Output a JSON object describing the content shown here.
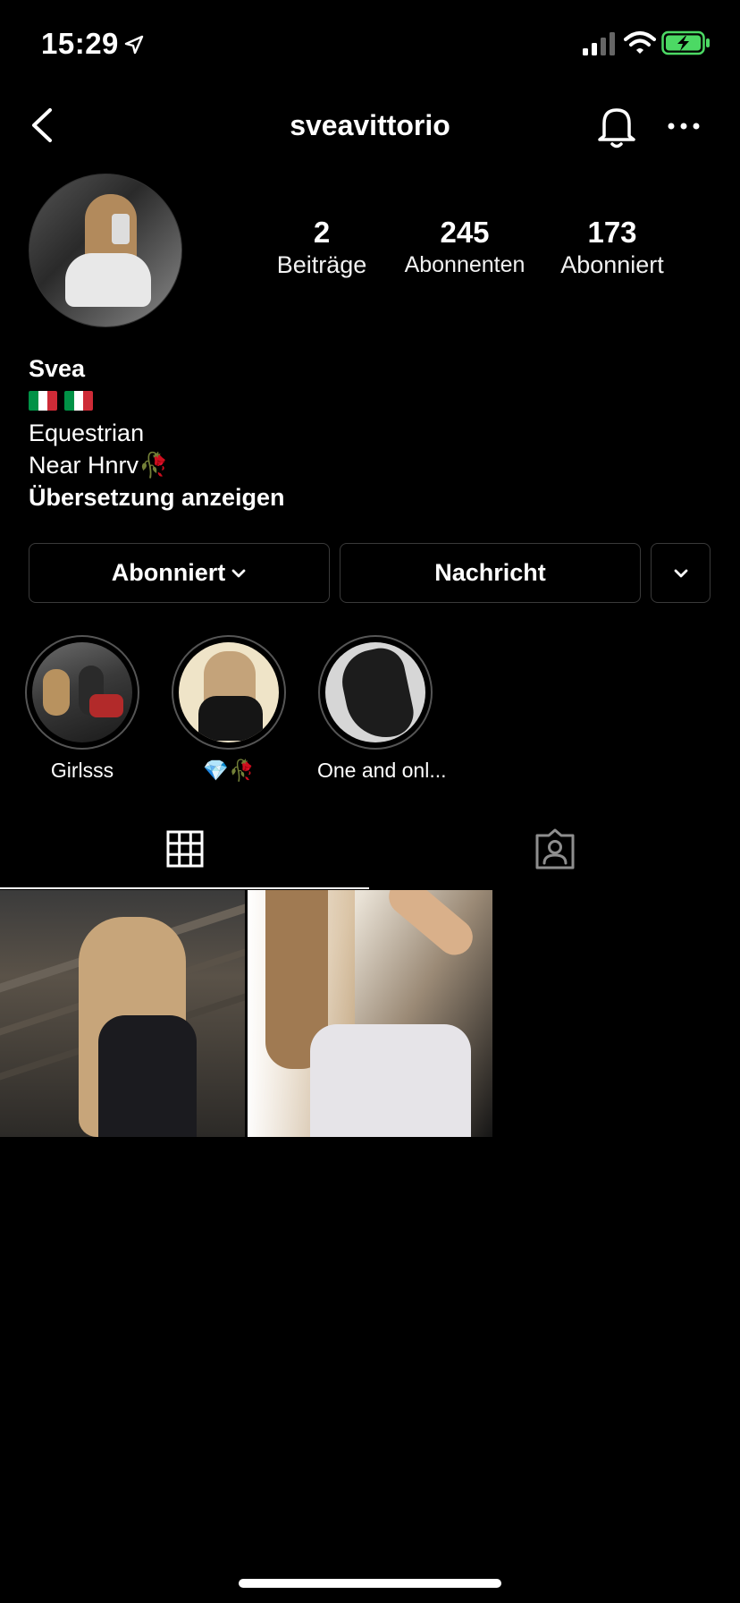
{
  "status_bar": {
    "time": "15:29",
    "icons": [
      "location-arrow-icon",
      "cellular-signal-icon",
      "wifi-icon",
      "battery-charging-icon"
    ],
    "battery_color": "#4cd964"
  },
  "nav": {
    "username": "sveavittorio",
    "icons": [
      "chevron-left-icon",
      "bell-icon",
      "more-dots-icon"
    ]
  },
  "profile": {
    "stats": [
      {
        "value": "2",
        "label": "Beiträge"
      },
      {
        "value": "245",
        "label": "Abonnenten"
      },
      {
        "value": "173",
        "label": "Abonniert"
      }
    ],
    "bio": {
      "name": "Svea",
      "flags": [
        "italy-flag-icon",
        "italy-flag-icon"
      ],
      "line1": "Equestrian",
      "line2": "Near Hnrv🥀",
      "translate": "Übersetzung anzeigen"
    }
  },
  "actions": {
    "follow_label": "Abonniert",
    "message_label": "Nachricht"
  },
  "highlights": [
    {
      "label": "Girlsss"
    },
    {
      "label": "💎🥀"
    },
    {
      "label": "One and onl..."
    }
  ],
  "tabs": {
    "active": "grid",
    "icons": [
      "grid-icon",
      "tagged-person-icon"
    ]
  },
  "posts_count_shown": 2,
  "colors": {
    "background": "#000000",
    "text": "#ffffff",
    "border": "#3a3a3a",
    "flag_green": "#009246",
    "flag_red": "#ce2b37"
  }
}
